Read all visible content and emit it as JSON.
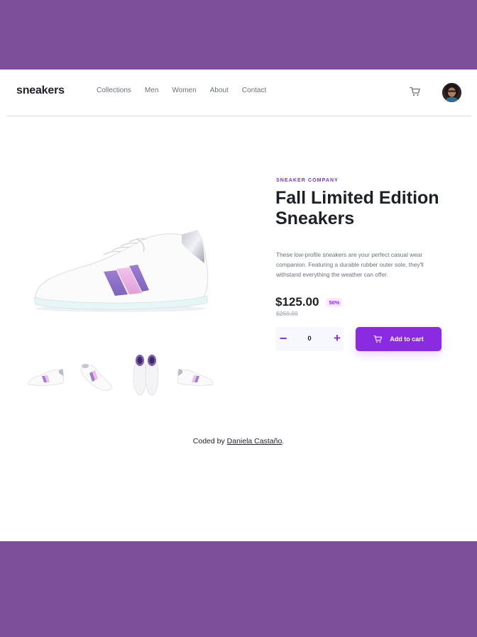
{
  "brand": {
    "logo": "sneakers"
  },
  "nav": {
    "links": [
      "Collections",
      "Men",
      "Women",
      "About",
      "Contact"
    ]
  },
  "icons": {
    "cart": "cart-icon",
    "avatar": "user-avatar",
    "minus": "minus-icon",
    "plus": "plus-icon"
  },
  "product": {
    "company": "Sneaker Company",
    "title": "Fall Limited Edition Sneakers",
    "description": "These low-profile sneakers are your perfect casual wear companion. Featuring a durable rubber outer sole, they'll withstand everything the weather can offer.",
    "price": "$125.00",
    "discount": "50%",
    "old_price": "$250.00",
    "quantity": "0",
    "add_to_cart_label": "Add to cart",
    "minus_label": "−",
    "plus_label": "+"
  },
  "footer": {
    "prefix": "Coded by ",
    "author": "Daniela Castaño",
    "suffix": "."
  },
  "colors": {
    "accent": "#8a2be2",
    "background": "#7d4f9a",
    "text": "#1d2026",
    "muted": "#68707d"
  }
}
